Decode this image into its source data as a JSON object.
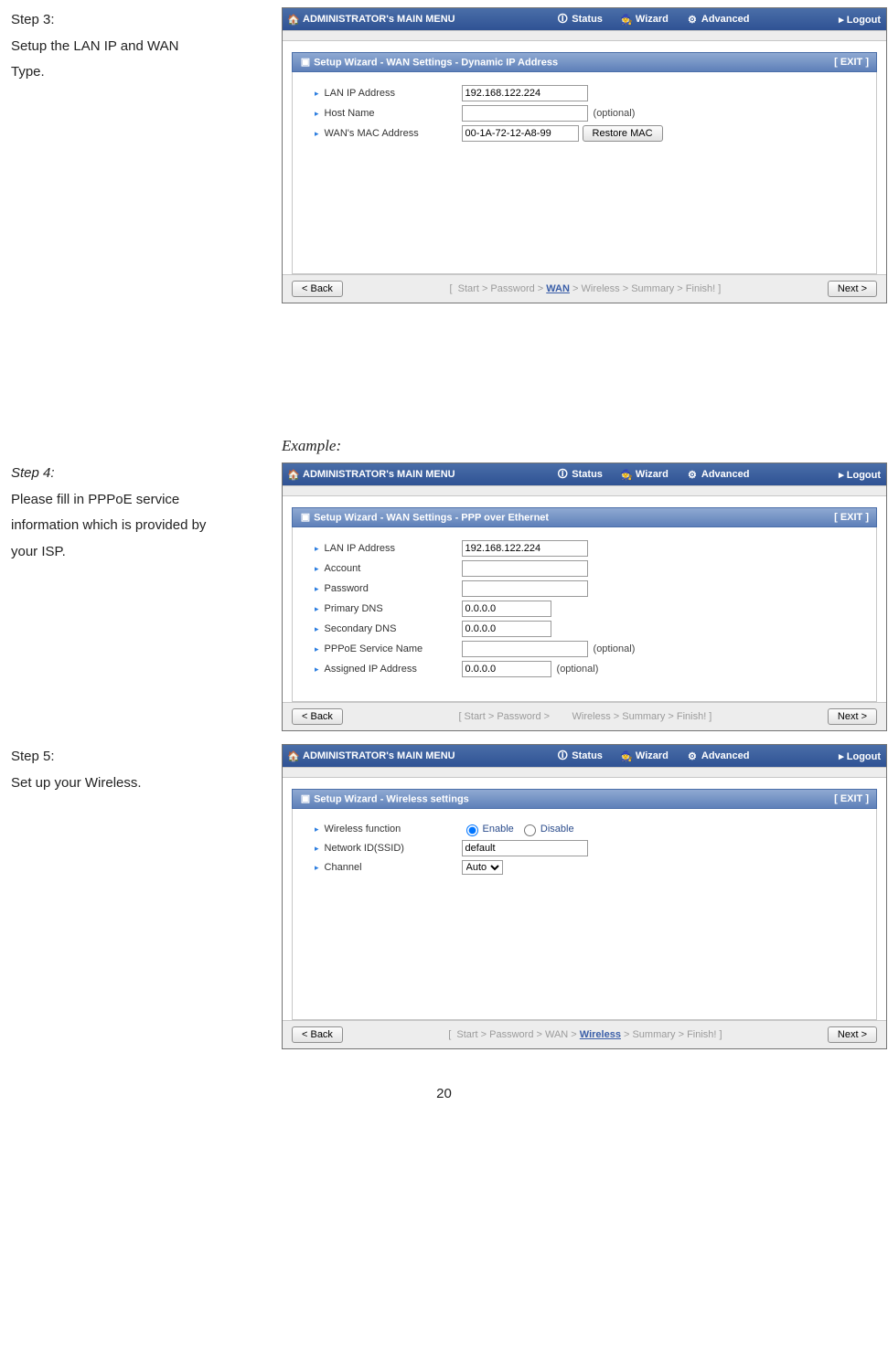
{
  "page_number": "20",
  "step3": {
    "heading": "Step 3:",
    "desc_l1": "Setup the LAN IP and WAN",
    "desc_l2": "Type."
  },
  "step4": {
    "heading": "Step 4:",
    "desc_l1": "Please fill in PPPoE service",
    "desc_l2": "information which is provided by",
    "desc_l3": "your ISP.",
    "example": "Example:"
  },
  "step5": {
    "heading": "Step 5:",
    "desc": "Set up your Wireless."
  },
  "nav": {
    "brand": "ADMINISTRATOR's MAIN MENU",
    "status": "Status",
    "wizard": "Wizard",
    "advanced": "Advanced",
    "logout": "Logout",
    "logout_arrow": "▸"
  },
  "ui": {
    "exit": "[ EXIT ]",
    "back": "< Back",
    "next": "Next >",
    "inbullet": "▸",
    "optional": "(optional)"
  },
  "panel1": {
    "title": "Setup Wizard - WAN Settings - Dynamic IP Address",
    "lan_lbl": "LAN IP Address",
    "lan_val": "192.168.122.224",
    "host_lbl": "Host Name",
    "host_val": "",
    "mac_lbl": "WAN's MAC Address",
    "mac_val": "00-1A-72-12-A8-99",
    "restore": "Restore MAC",
    "crumb_text": "[  Start > Password > WAN > Wireless > Summary > Finish! ]",
    "crumb_active": "WAN"
  },
  "panel2": {
    "title": "Setup Wizard - WAN Settings - PPP over Ethernet",
    "lan_lbl": "LAN IP Address",
    "lan_val": "192.168.122.224",
    "acct_lbl": "Account",
    "acct_val": "",
    "pass_lbl": "Password",
    "pass_val": "",
    "pdns_lbl": "Primary DNS",
    "pdns_val": "0.0.0.0",
    "sdns_lbl": "Secondary DNS",
    "sdns_val": "0.0.0.0",
    "svc_lbl": "PPPoE Service Name",
    "svc_val": "",
    "aip_lbl": "Assigned IP Address",
    "aip_val": "0.0.0.0",
    "crumb_text_a": "[  Start > Password >",
    "crumb_text_b": "Wireless > Summary > Finish! ]"
  },
  "panel3": {
    "title": "Setup Wizard - Wireless settings",
    "wfn_lbl": "Wireless function",
    "enable": "Enable",
    "disable": "Disable",
    "ssid_lbl": "Network ID(SSID)",
    "ssid_val": "default",
    "chan_lbl": "Channel",
    "chan_val": "Auto",
    "crumb_text": "[  Start > Password > WAN > Wireless > Summary > Finish! ]",
    "crumb_active": "Wireless"
  }
}
